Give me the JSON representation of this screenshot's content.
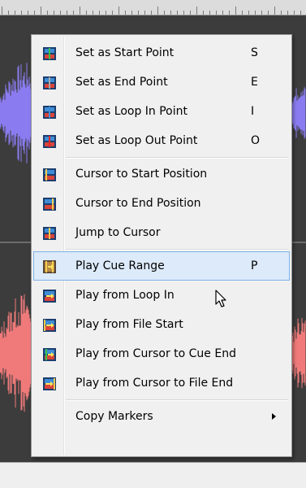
{
  "menu": {
    "items": [
      {
        "label": "Set as Start Point",
        "shortcut": "S"
      },
      {
        "label": "Set as End Point",
        "shortcut": "E"
      },
      {
        "label": "Set as Loop In Point",
        "shortcut": "I"
      },
      {
        "label": "Set as Loop Out Point",
        "shortcut": "O"
      },
      {
        "label": "Cursor to Start Position",
        "shortcut": ""
      },
      {
        "label": "Cursor to End Position",
        "shortcut": ""
      },
      {
        "label": "Jump to Cursor",
        "shortcut": ""
      },
      {
        "label": "Play Cue Range",
        "shortcut": "P"
      },
      {
        "label": "Play from Loop In",
        "shortcut": ""
      },
      {
        "label": "Play from File Start",
        "shortcut": ""
      },
      {
        "label": "Play from Cursor to Cue End",
        "shortcut": ""
      },
      {
        "label": "Play from Cursor to File End",
        "shortcut": ""
      },
      {
        "label": "Copy Markers",
        "shortcut": ""
      }
    ]
  },
  "colors": {
    "menu_background": "#f0f0f0",
    "hover_background": "#dceaf9",
    "hover_border": "#7fb2e6",
    "waveform_top": "#8a7cf0",
    "waveform_bottom": "#f07a7a",
    "editor_background": "#3c3c3c"
  }
}
